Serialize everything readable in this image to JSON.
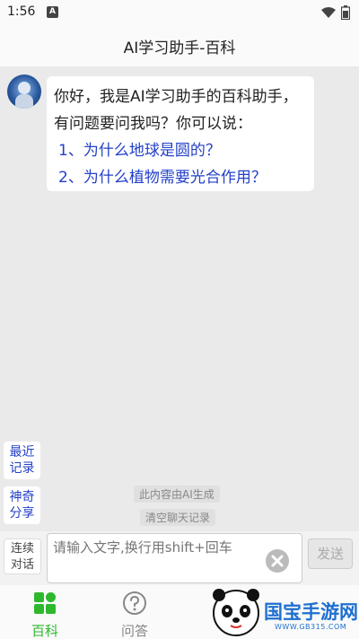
{
  "status": {
    "time": "1:56",
    "notif_badge": "A"
  },
  "header": {
    "title": "AI学习助手-百科"
  },
  "chat": {
    "greeting": "你好，我是AI学习助手的百科助手，有问题要问我吗？你可以说：",
    "suggestions": [
      "1、为什么地球是圆的？",
      "2、为什么植物需要光合作用？"
    ]
  },
  "side_buttons": {
    "recent": [
      "最近",
      "记录"
    ],
    "magic": [
      "神奇",
      "分享"
    ]
  },
  "notices": {
    "ai_generated": "此内容由AI生成",
    "clear_chat": "清空聊天记录"
  },
  "input": {
    "continuous": [
      "连续",
      "对话"
    ],
    "placeholder": "请输入文字,换行用shift+回车",
    "send_label": "发送"
  },
  "nav": {
    "items": [
      {
        "label": "百科",
        "icon": "grid-icon",
        "active": true
      },
      {
        "label": "问答",
        "icon": "question-circle-icon",
        "active": false
      }
    ]
  },
  "watermark": {
    "brand": "国宝手游网",
    "url": "WWW.GB315.COM"
  },
  "colors": {
    "accent_blue": "#2340c8",
    "nav_active": "#2db82d",
    "brand_blue": "#1e6fd0"
  }
}
